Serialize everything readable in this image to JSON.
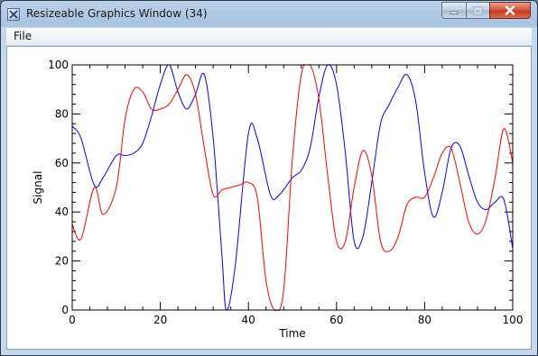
{
  "window": {
    "title": "Resizeable Graphics Window (34)",
    "controls": [
      "minimize",
      "maximize",
      "close"
    ]
  },
  "menu": {
    "items": [
      "File"
    ]
  },
  "chart_data": {
    "type": "line",
    "xlabel": "Time",
    "ylabel": "Signal",
    "xlim": [
      0,
      100
    ],
    "ylim": [
      0,
      100
    ],
    "x_ticks": [
      0,
      20,
      40,
      60,
      80,
      100
    ],
    "y_ticks": [
      0,
      20,
      40,
      60,
      80,
      100
    ],
    "grid": false,
    "series": [
      {
        "color": "#0000ff",
        "x": [
          0,
          2,
          5,
          7,
          10,
          12,
          14,
          16,
          18,
          20,
          22,
          24,
          26,
          28,
          30,
          32,
          34,
          35,
          37,
          40,
          42,
          45,
          47,
          50,
          52,
          54,
          56,
          58,
          60,
          62,
          64,
          66,
          68,
          70,
          72,
          74,
          76,
          78,
          80,
          82,
          84,
          86,
          88,
          90,
          92,
          94,
          96,
          98,
          100
        ],
        "y": [
          75,
          70,
          51,
          54,
          63,
          63,
          64,
          68,
          79,
          92,
          100,
          89,
          82,
          88,
          96,
          70,
          22,
          0,
          18,
          72,
          70,
          47,
          47,
          54,
          57,
          66,
          87,
          100,
          92,
          64,
          28,
          30,
          52,
          76,
          84,
          91,
          96,
          85,
          56,
          38,
          48,
          66,
          67,
          55,
          44,
          41,
          44,
          45,
          25
        ]
      },
      {
        "color": "#ff0000",
        "x": [
          0,
          2,
          5,
          7,
          10,
          12,
          14,
          16,
          18,
          20,
          22,
          24,
          26,
          28,
          30,
          32,
          34,
          36,
          38,
          40,
          42,
          44,
          46,
          48,
          50,
          52,
          54,
          56,
          58,
          60,
          62,
          64,
          66,
          68,
          70,
          72,
          74,
          76,
          78,
          80,
          82,
          84,
          86,
          88,
          90,
          92,
          94,
          96,
          98,
          100
        ],
        "y": [
          35,
          29,
          50,
          39,
          50,
          78,
          90,
          89,
          82,
          82,
          84,
          90,
          96,
          88,
          66,
          47,
          49,
          50,
          51,
          52,
          46,
          12,
          0,
          8,
          62,
          96,
          100,
          86,
          55,
          28,
          28,
          50,
          65,
          55,
          28,
          24,
          30,
          43,
          46,
          46,
          54,
          64,
          66,
          52,
          36,
          31,
          37,
          54,
          74,
          60
        ]
      }
    ]
  }
}
